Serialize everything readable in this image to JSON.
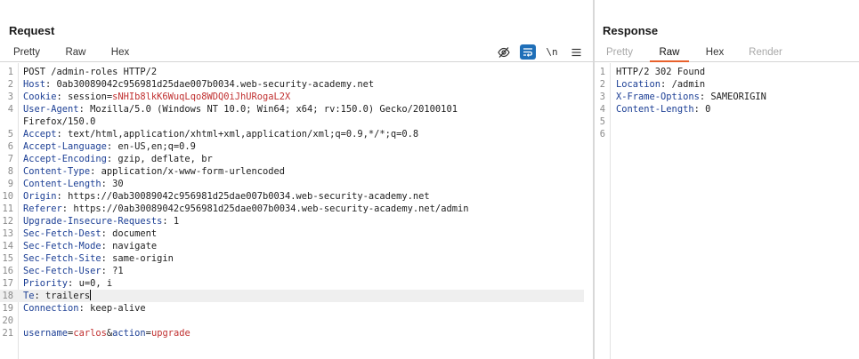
{
  "request": {
    "title": "Request",
    "tabs": [
      {
        "label": "Pretty",
        "active": true
      },
      {
        "label": "Raw",
        "active": false
      },
      {
        "label": "Hex",
        "active": false
      }
    ],
    "toolbar": {
      "hide_icon": "eye-slash-icon",
      "wrap_icon": "text-wrap-icon",
      "newline_label": "\\n",
      "menu_icon": "hamburger-menu-icon"
    },
    "lines": [
      {
        "n": "1",
        "name": "",
        "sep": "",
        "value": "POST /admin-roles HTTP/2"
      },
      {
        "n": "2",
        "name": "Host",
        "sep": ": ",
        "value": "0ab30089042c956981d25dae007b0034.web-security-academy.net"
      },
      {
        "n": "3",
        "name": "Cookie",
        "sep": ": ",
        "value": "session=",
        "cookie": "sNHIb8lkK6WuqLqo8WDQ0iJhURogaL2X"
      },
      {
        "n": "4",
        "name": "User-Agent",
        "sep": ": ",
        "value": "Mozilla/5.0 (Windows NT 10.0; Win64; x64; rv:150.0) Gecko/20100101"
      },
      {
        "n": "",
        "name": "",
        "sep": "",
        "value": "Firefox/150.0"
      },
      {
        "n": "5",
        "name": "Accept",
        "sep": ": ",
        "value": "text/html,application/xhtml+xml,application/xml;q=0.9,*/*;q=0.8"
      },
      {
        "n": "6",
        "name": "Accept-Language",
        "sep": ": ",
        "value": "en-US,en;q=0.9"
      },
      {
        "n": "7",
        "name": "Accept-Encoding",
        "sep": ": ",
        "value": "gzip, deflate, br"
      },
      {
        "n": "8",
        "name": "Content-Type",
        "sep": ": ",
        "value": "application/x-www-form-urlencoded"
      },
      {
        "n": "9",
        "name": "Content-Length",
        "sep": ": ",
        "value": "30"
      },
      {
        "n": "10",
        "name": "Origin",
        "sep": ": ",
        "value": "https://0ab30089042c956981d25dae007b0034.web-security-academy.net"
      },
      {
        "n": "11",
        "name": "Referer",
        "sep": ": ",
        "value": "https://0ab30089042c956981d25dae007b0034.web-security-academy.net/admin"
      },
      {
        "n": "12",
        "name": "Upgrade-Insecure-Requests",
        "sep": ": ",
        "value": "1"
      },
      {
        "n": "13",
        "name": "Sec-Fetch-Dest",
        "sep": ": ",
        "value": "document"
      },
      {
        "n": "14",
        "name": "Sec-Fetch-Mode",
        "sep": ": ",
        "value": "navigate"
      },
      {
        "n": "15",
        "name": "Sec-Fetch-Site",
        "sep": ": ",
        "value": "same-origin"
      },
      {
        "n": "16",
        "name": "Sec-Fetch-User",
        "sep": ": ",
        "value": "?1"
      },
      {
        "n": "17",
        "name": "Priority",
        "sep": ": ",
        "value": "u=0, i"
      },
      {
        "n": "18",
        "name": "Te",
        "sep": ": ",
        "value": "trailers",
        "current": true
      },
      {
        "n": "19",
        "name": "Connection",
        "sep": ": ",
        "value": "keep-alive"
      },
      {
        "n": "20",
        "name": "",
        "sep": "",
        "value": ""
      },
      {
        "n": "21",
        "body": [
          {
            "k": "username",
            "v": "carlos"
          },
          {
            "k": "action",
            "v": "upgrade"
          }
        ]
      }
    ]
  },
  "response": {
    "title": "Response",
    "tabs": [
      {
        "label": "Pretty",
        "active": false,
        "disabled": true
      },
      {
        "label": "Raw",
        "active": true
      },
      {
        "label": "Hex",
        "active": false
      },
      {
        "label": "Render",
        "active": false,
        "disabled": true
      }
    ],
    "lines": [
      {
        "n": "1",
        "name": "",
        "sep": "",
        "value": "HTTP/2 302 Found"
      },
      {
        "n": "2",
        "name": "Location",
        "sep": ": ",
        "value": "/admin"
      },
      {
        "n": "3",
        "name": "X-Frame-Options",
        "sep": ": ",
        "value": "SAMEORIGIN"
      },
      {
        "n": "4",
        "name": "Content-Length",
        "sep": ": ",
        "value": "0"
      },
      {
        "n": "5",
        "name": "",
        "sep": "",
        "value": ""
      },
      {
        "n": "6",
        "name": "",
        "sep": "",
        "value": ""
      }
    ]
  },
  "colors": {
    "accent": "#e8612c",
    "header_name": "#1c3f95",
    "cookie_value": "#c03030",
    "wrap_button": "#1f6fb8"
  }
}
